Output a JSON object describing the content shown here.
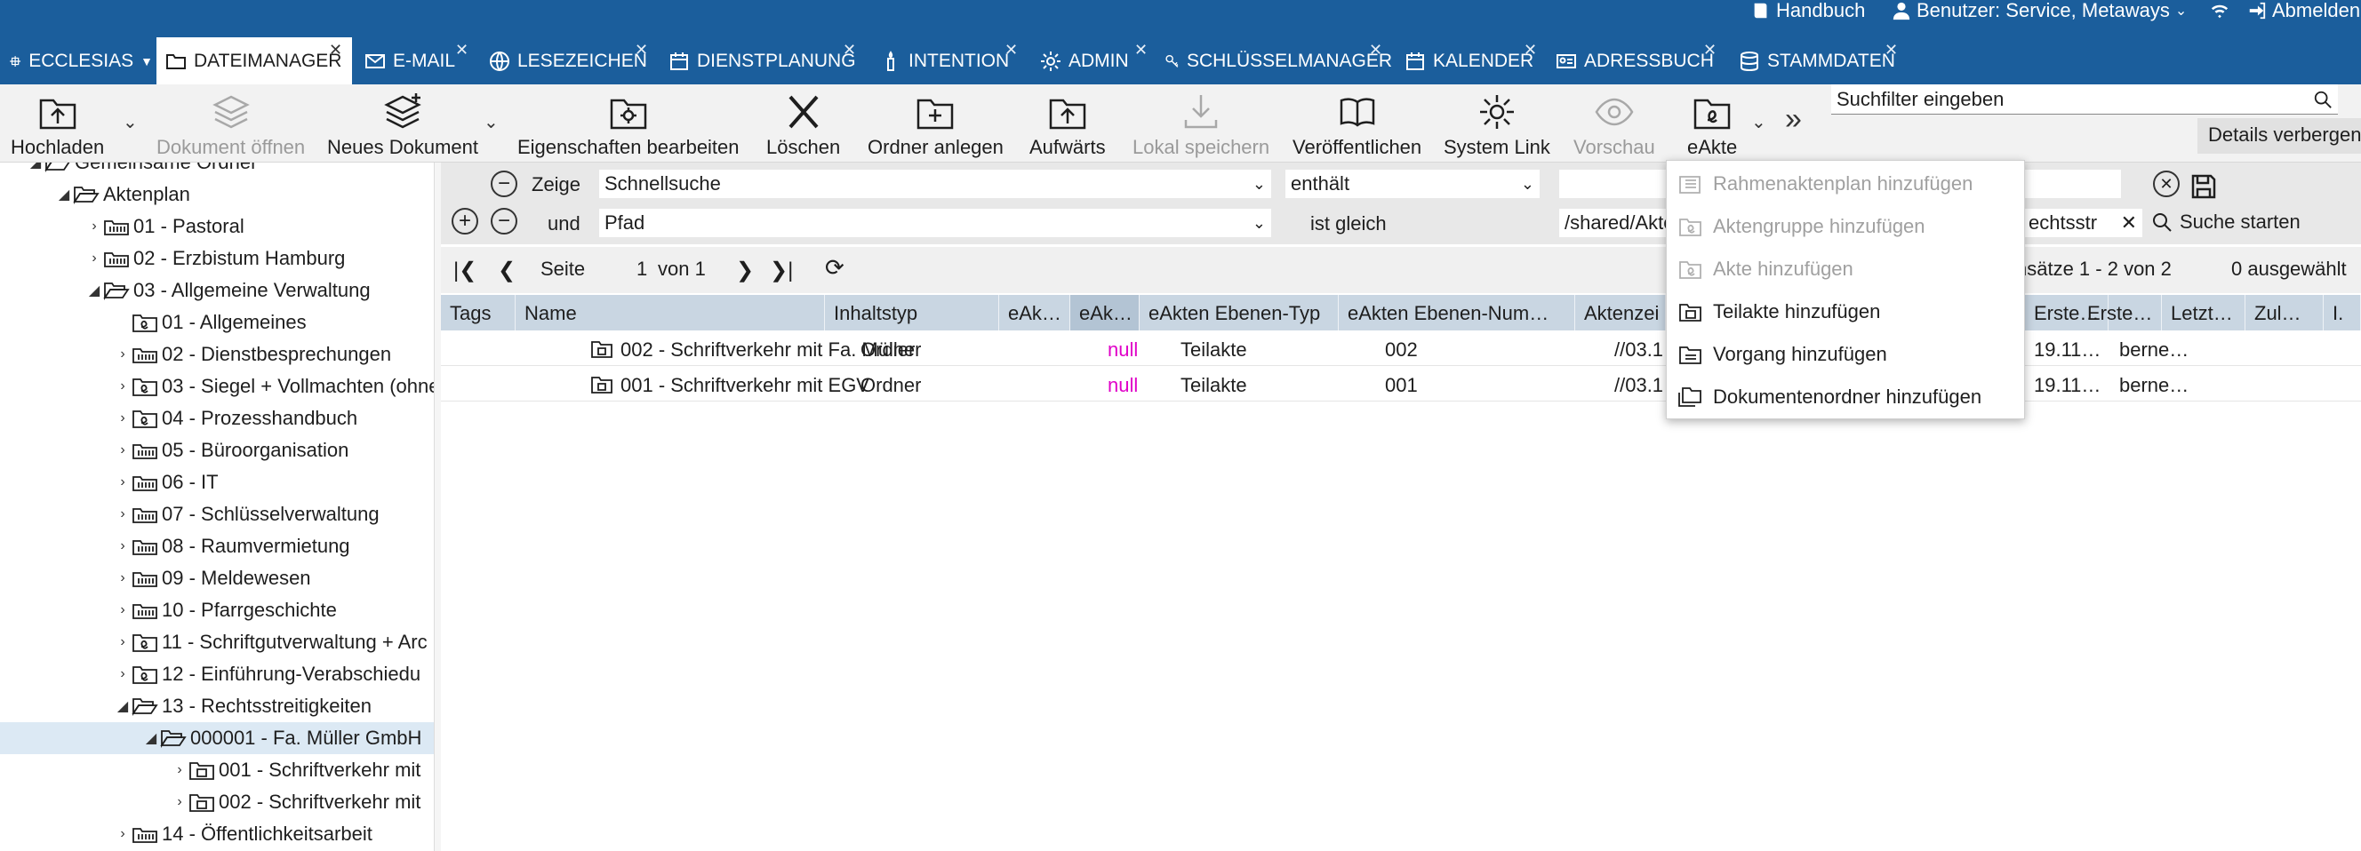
{
  "top_links": {
    "handbook": "Handbuch",
    "user": "Benutzer: Service, Metaways",
    "logout": "Abmelden"
  },
  "tabs": [
    {
      "label": "ECCLESIAS"
    },
    {
      "label": "DATEIMANAGER"
    },
    {
      "label": "E-MAIL"
    },
    {
      "label": "LESEZEICHEN"
    },
    {
      "label": "DIENSTPLANUNG"
    },
    {
      "label": "INTENTION"
    },
    {
      "label": "ADMIN"
    },
    {
      "label": "SCHLÜSSELMANAGER"
    },
    {
      "label": "KALENDER"
    },
    {
      "label": "ADRESSBUCH"
    },
    {
      "label": "STAMMDATEN"
    }
  ],
  "toolbar": {
    "upload": "Hochladen",
    "open_doc": "Dokument öffnen",
    "new_doc": "Neues Dokument",
    "edit_props": "Eigenschaften bearbeiten",
    "delete": "Löschen",
    "new_folder": "Ordner anlegen",
    "up": "Aufwärts",
    "save_local": "Lokal speichern",
    "publish": "Veröffentlichen",
    "system_link": "System Link",
    "preview": "Vorschau",
    "eakte": "eAkte",
    "search_placeholder": "Suchfilter eingeben",
    "details_toggle": "Details verbergen"
  },
  "tree": {
    "items": [
      {
        "label": "Gemeinsame Ordner"
      },
      {
        "label": "Aktenplan"
      },
      {
        "label": "01 - Pastoral"
      },
      {
        "label": "02 - Erzbistum Hamburg"
      },
      {
        "label": "03 - Allgemeine Verwaltung"
      },
      {
        "label": "01 - Allgemeines"
      },
      {
        "label": "02 - Dienstbesprechungen"
      },
      {
        "label": "03 - Siegel + Vollmachten (ohne"
      },
      {
        "label": "04 - Prozesshandbuch"
      },
      {
        "label": "05 - Büroorganisation"
      },
      {
        "label": "06 - IT"
      },
      {
        "label": "07 - Schlüsselverwaltung"
      },
      {
        "label": "08 - Raumvermietung"
      },
      {
        "label": "09 - Meldewesen"
      },
      {
        "label": "10 - Pfarrgeschichte"
      },
      {
        "label": "11 - Schriftgutverwaltung + Arc"
      },
      {
        "label": "12 - Einführung-Verabschiedu"
      },
      {
        "label": "13 - Rechtsstreitigkeiten"
      },
      {
        "label": "000001 - Fa. Müller GmbH"
      },
      {
        "label": "001 - Schriftverkehr mit"
      },
      {
        "label": "002 - Schriftverkehr mit"
      },
      {
        "label": "14 - Öffentlichkeitsarbeit"
      }
    ]
  },
  "filter": {
    "row1": {
      "label": "Zeige",
      "field": "Schnellsuche",
      "operator": "enthält",
      "value": ""
    },
    "row2": {
      "label": "und",
      "field": "Pfad",
      "operator": "ist gleich",
      "value": "/shared/Akte",
      "value_tail": "echtsstr"
    },
    "start_search": "Suche starten"
  },
  "pager": {
    "page_label": "Seite",
    "page": "1",
    "of": "von 1",
    "records": "nsätze 1 - 2 von 2",
    "selected": "0 ausgewählt"
  },
  "grid": {
    "columns": [
      "Tags",
      "Name",
      "Inhaltstyp",
      "eAk…",
      "eAk…",
      "eAkten Ebenen-Typ",
      "eAkten Ebenen-Num…",
      "Aktenzei",
      "Erste…",
      "Erste…",
      "Letzt…",
      "Zul…",
      "I."
    ],
    "rows": [
      {
        "name": "002 - Schriftverkehr mit Fa. Müller",
        "type": "Ordner",
        "eak2": "null",
        "level_type": "Teilakte",
        "level_num": "002",
        "aktenzeichen": "//03.1",
        "created": "19.11…",
        "creator": "berne…"
      },
      {
        "name": "001 - Schriftverkehr mit EGV",
        "type": "Ordner",
        "eak2": "null",
        "level_type": "Teilakte",
        "level_num": "001",
        "aktenzeichen": "//03.1",
        "created": "19.11…",
        "creator": "berne…"
      }
    ]
  },
  "menu": {
    "items": [
      {
        "label": "Rahmenaktenplan hinzufügen",
        "enabled": false
      },
      {
        "label": "Aktengruppe hinzufügen",
        "enabled": false
      },
      {
        "label": "Akte hinzufügen",
        "enabled": false
      },
      {
        "label": "Teilakte hinzufügen",
        "enabled": true
      },
      {
        "label": "Vorgang hinzufügen",
        "enabled": true
      },
      {
        "label": "Dokumentenordner hinzufügen",
        "enabled": true
      }
    ]
  },
  "colors": {
    "nav": "#1b5e9c",
    "null_text": "#e000c8",
    "header": "#c9d6e2",
    "selected_row": "#dce9f4"
  }
}
